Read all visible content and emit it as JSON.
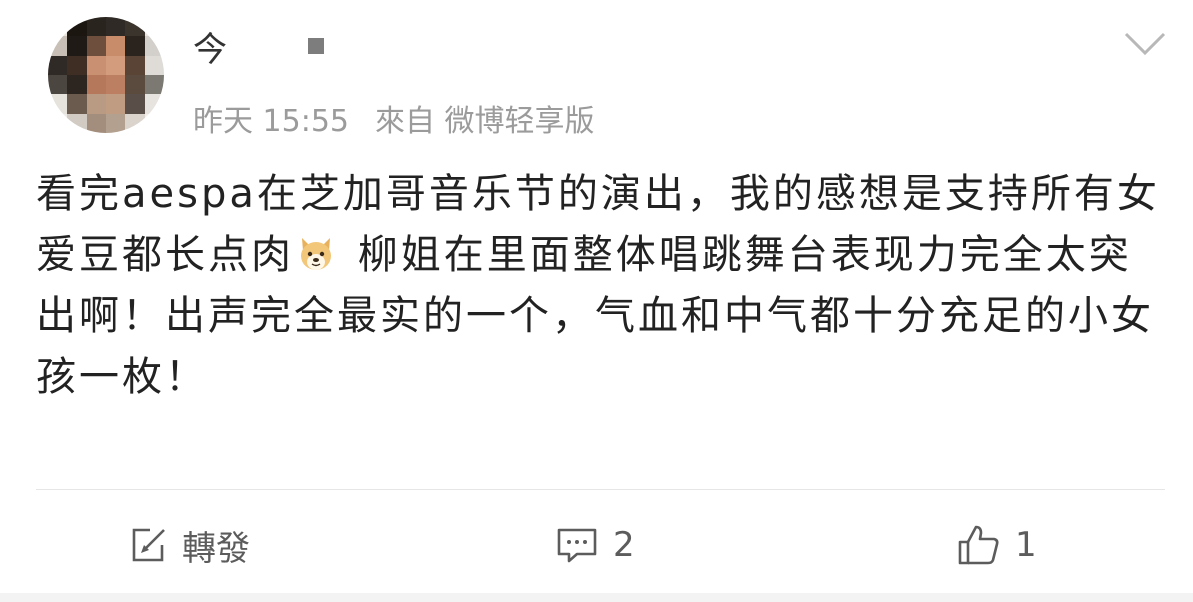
{
  "post": {
    "author_name": "今",
    "time": "昨天 15:55",
    "source": "來自 微博轻享版",
    "text_before_emoji": "看完aespa在芝加哥音乐节的演出，我的感想是支持所有女爱豆都长点肉",
    "emoji_icon": "doge-emoji-icon",
    "text_after_emoji": " 柳姐在里面整体唱跳舞台表现力完全太突出啊！出声完全最实的一个，气血和中气都十分充足的小女孩一枚！"
  },
  "actions": {
    "repost_label": "轉發",
    "comment_count": "2",
    "like_count": "1"
  },
  "colors": {
    "background": "#ffffff",
    "meta_text": "#9b9b9b",
    "body_text": "#222222",
    "action_text": "#5c5c5c"
  }
}
